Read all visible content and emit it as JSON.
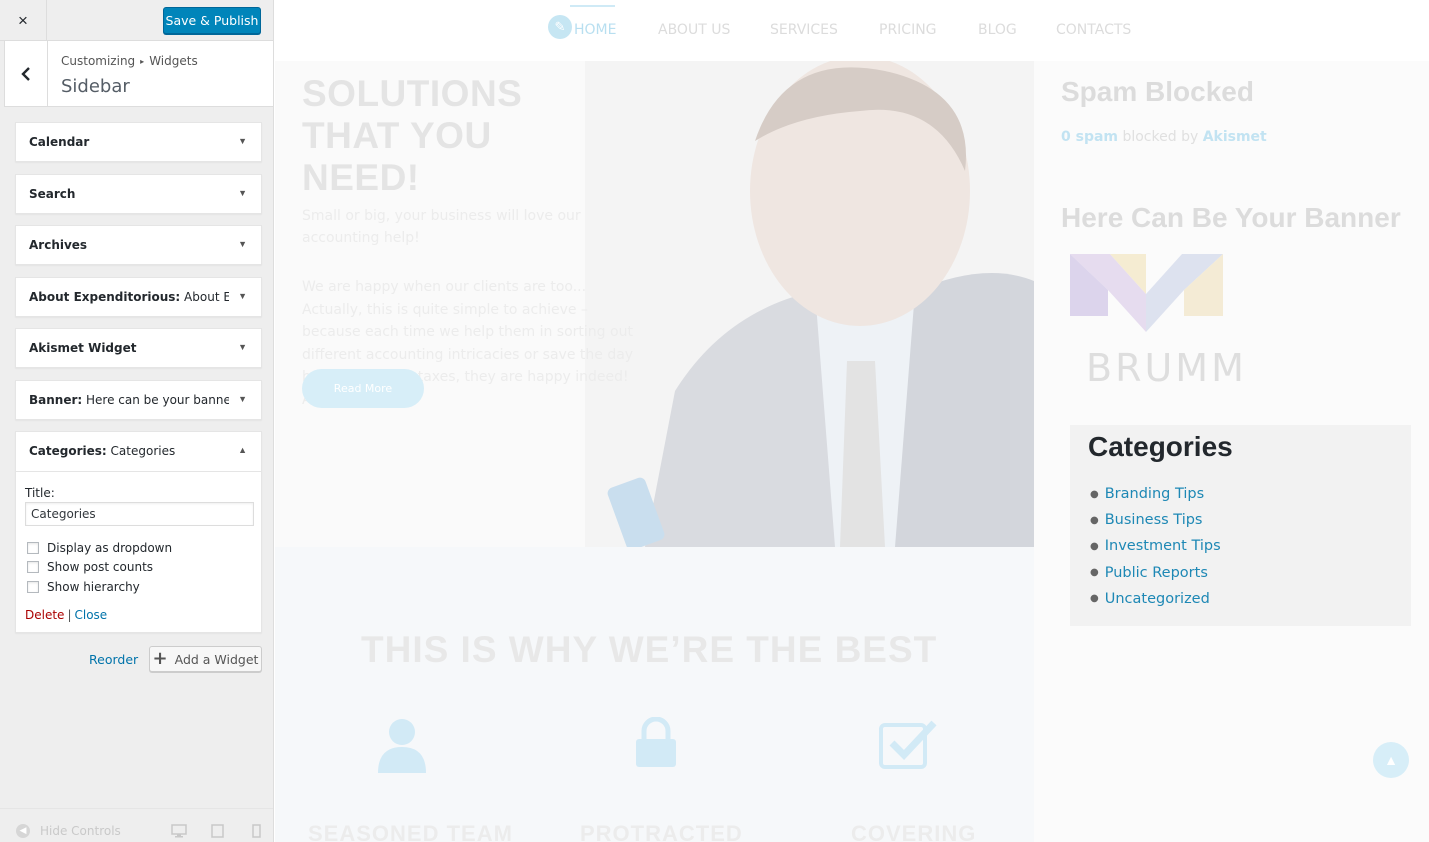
{
  "customizer": {
    "close_icon": "×",
    "save_label": "Save & Publish",
    "breadcrumb": [
      "Customizing",
      "Widgets"
    ],
    "breadcrumb_sep": "▸",
    "section_name": "Sidebar",
    "widgets": [
      {
        "title": "Calendar",
        "sub": ""
      },
      {
        "title": "Search",
        "sub": ""
      },
      {
        "title": "Archives",
        "sub": ""
      },
      {
        "title": "About Expenditorious:",
        "sub": " About Ex..."
      },
      {
        "title": "Akismet Widget",
        "sub": ""
      },
      {
        "title": "Banner:",
        "sub": " Here can be your banner"
      }
    ],
    "open_widget": {
      "title": "Categories:",
      "sub": " Categories",
      "title_label": "Title:",
      "title_value": "Categories",
      "checkboxes": [
        "Display as dropdown",
        "Show post counts",
        "Show hierarchy"
      ],
      "delete_label": "Delete",
      "pipe": "|",
      "close_label": "Close"
    },
    "reorder_label": "Reorder",
    "add_widget_label": "Add a Widget",
    "hide_controls_label": "Hide Controls"
  },
  "preview": {
    "nav": [
      "HOME",
      "ABOUT US",
      "SERVICES",
      "PRICING",
      "BLOG",
      "CONTACTS"
    ],
    "headline": [
      "SOLUTIONS",
      "THAT YOU NEED!"
    ],
    "para1": "Small or big, your business will love our accounting help!",
    "para2": "We are happy when our clients are too... Actually, this is quite simple to achieve – because each time we help them in sorting out different accounting intrica­cies or save the day before filing the taxes, they are happy indeed! And so are we!",
    "read_more": "Read More",
    "best_title": "THIS IS WHY WE’RE THE BEST",
    "features": [
      "SEASONED TEAM",
      "PROTRACTED",
      "COVERING"
    ],
    "spam_title": "Spam Blocked",
    "spam_count": "0 spam",
    "spam_mid": " blocked by ",
    "spam_brand": "Akismet",
    "banner_title": "Here Can Be Your Banner",
    "logo_text": "BRUMM",
    "categories_title": "Categories",
    "categories": [
      "Branding Tips",
      "Business Tips",
      "Investment Tips",
      "Public Reports",
      "Uncategorized"
    ]
  },
  "colors": {
    "accent": "#0085ba",
    "link": "#1e88b5",
    "delete": "#a00000"
  }
}
